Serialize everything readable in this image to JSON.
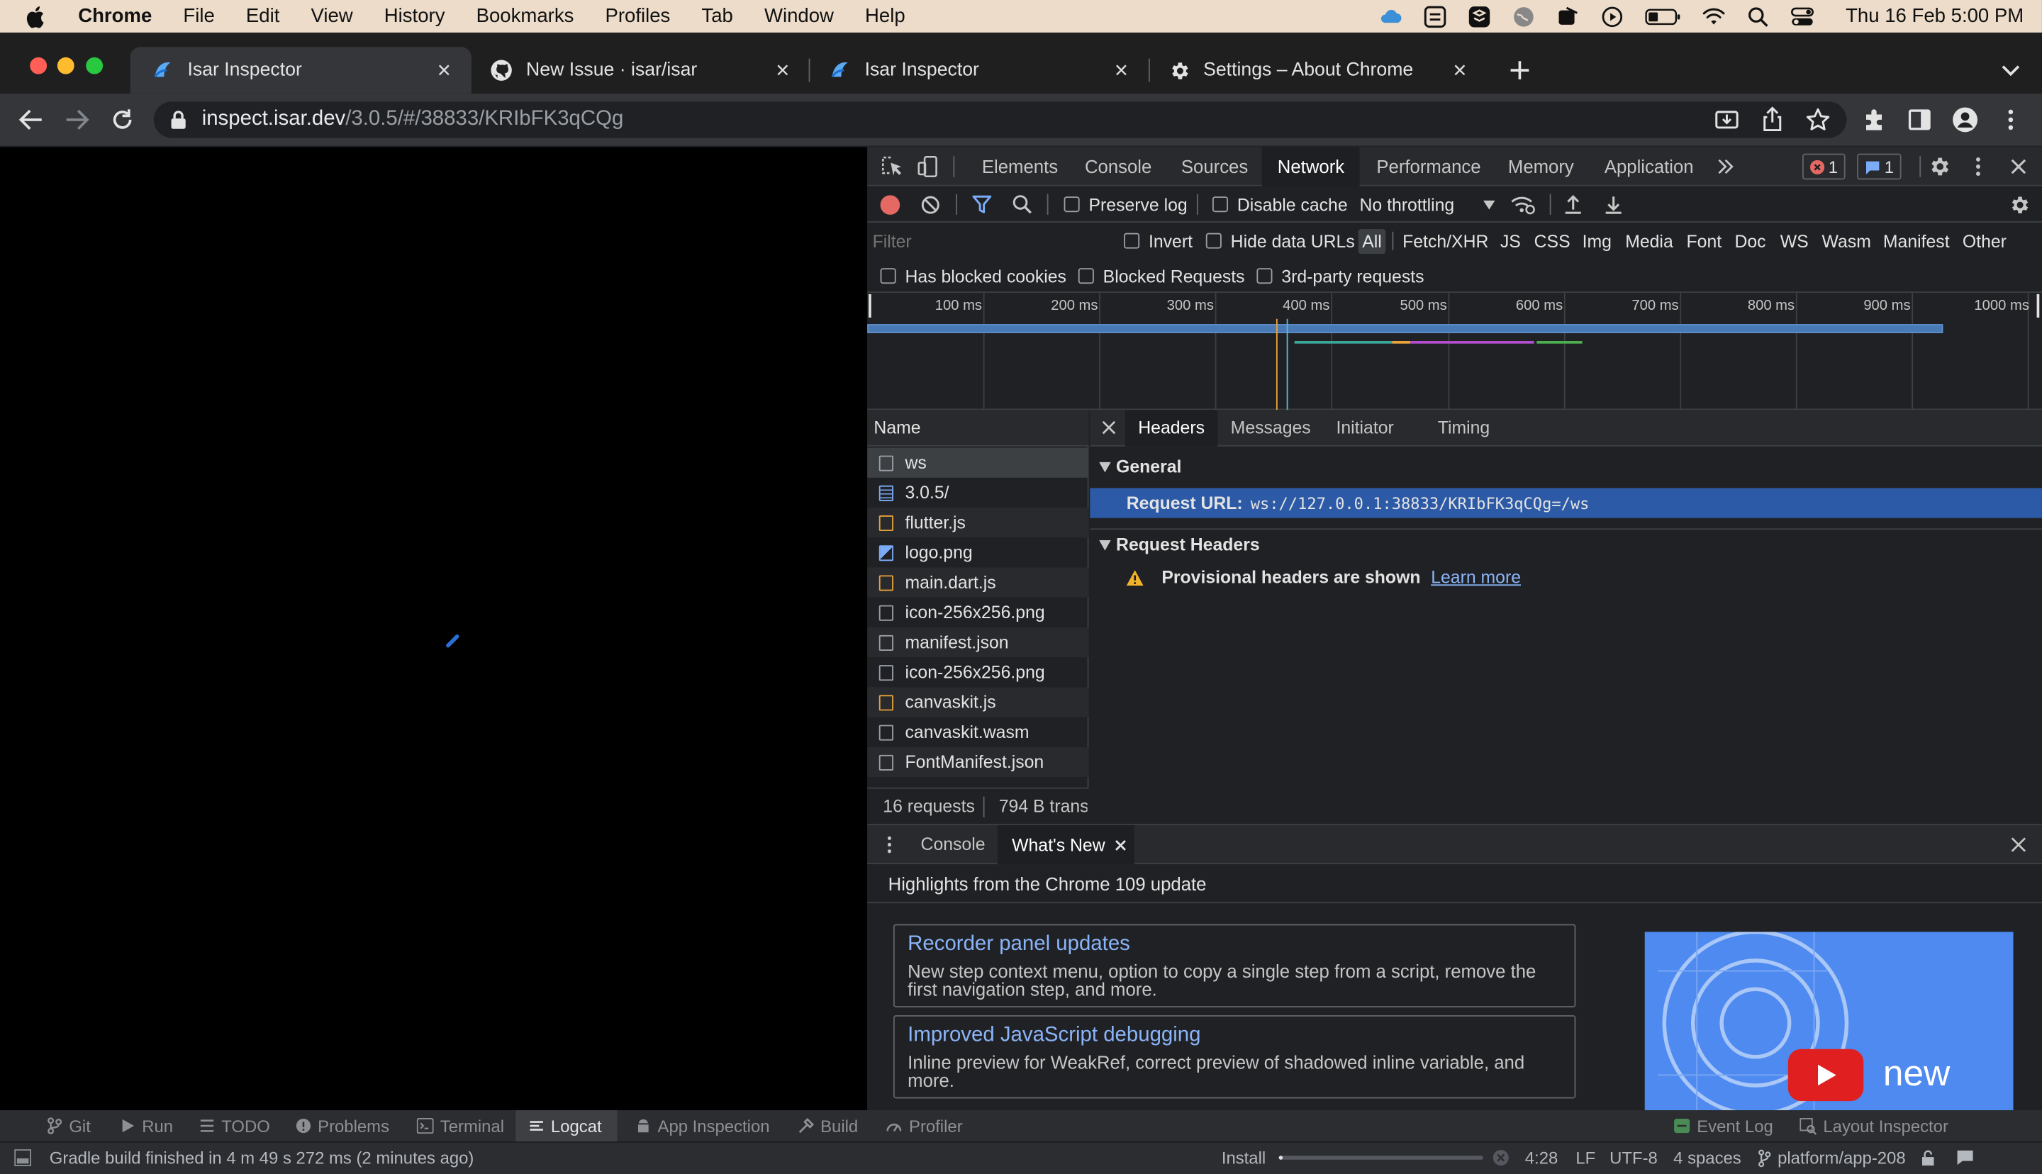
{
  "menubar": {
    "app": "Chrome",
    "items": [
      "File",
      "Edit",
      "View",
      "History",
      "Bookmarks",
      "Profiles",
      "Tab",
      "Window",
      "Help"
    ],
    "clock": "Thu 16 Feb  5:00 PM"
  },
  "tabs": [
    {
      "title": "Isar Inspector",
      "icon": "isar-logo-icon"
    },
    {
      "title": "New Issue · isar/isar",
      "icon": "github-icon"
    },
    {
      "title": "Isar Inspector",
      "icon": "isar-logo-icon"
    },
    {
      "title": "Settings – About Chrome",
      "icon": "gear-icon"
    }
  ],
  "address": {
    "host": "inspect.isar.dev",
    "path": "/3.0.5/#/38833/KRIbFK3qCQg"
  },
  "devtools": {
    "panels": [
      "Elements",
      "Console",
      "Sources",
      "Network",
      "Performance",
      "Memory",
      "Application"
    ],
    "active_panel": "Network",
    "error_count": "1",
    "message_count": "1",
    "netbar": {
      "preserve_log": "Preserve log",
      "disable_cache": "Disable cache",
      "throttling": "No throttling"
    },
    "filter": {
      "placeholder": "Filter",
      "invert": "Invert",
      "hide_data_urls": "Hide data URLs"
    },
    "types": [
      "All",
      "Fetch/XHR",
      "JS",
      "CSS",
      "Img",
      "Media",
      "Font",
      "Doc",
      "WS",
      "Wasm",
      "Manifest",
      "Other"
    ],
    "blocked": {
      "cookies": "Has blocked cookies",
      "requests": "Blocked Requests",
      "third_party": "3rd-party requests"
    },
    "timeline_ticks": [
      "100 ms",
      "200 ms",
      "300 ms",
      "400 ms",
      "500 ms",
      "600 ms",
      "700 ms",
      "800 ms",
      "900 ms",
      "1000 ms"
    ],
    "name_header": "Name",
    "requests": [
      "ws",
      "3.0.5/",
      "flutter.js",
      "logo.png",
      "main.dart.js",
      "icon-256x256.png",
      "manifest.json",
      "icon-256x256.png",
      "canvaskit.js",
      "canvaskit.wasm",
      "FontManifest.json"
    ],
    "summary": {
      "count": "16 requests",
      "transferred": "794 B trans"
    },
    "detail_tabs": [
      "Headers",
      "Messages",
      "Initiator",
      "Timing"
    ],
    "general_title": "General",
    "request_url_label": "Request URL:",
    "request_url_value": "ws://127.0.0.1:38833/KRIbFK3qCQg=/ws",
    "request_headers_title": "Request Headers",
    "provisional_text": "Provisional headers are shown",
    "learn_more": "Learn more",
    "drawer": {
      "tabs": [
        "Console",
        "What's New"
      ],
      "highlight": "Highlights from the Chrome 109 update",
      "cards": [
        {
          "title": "Recorder panel updates",
          "desc": "New step context menu, option to copy a single step from a script, remove the first navigation step, and more."
        },
        {
          "title": "Improved JavaScript debugging",
          "desc": "Inline preview for WeakRef, correct preview of shadowed inline variable, and more."
        }
      ],
      "video_label": "new"
    }
  },
  "ide": {
    "tools": [
      "Git",
      "Run",
      "TODO",
      "Problems",
      "Terminal",
      "Logcat",
      "App Inspection",
      "Build",
      "Profiler"
    ],
    "right_tools": [
      "Event Log",
      "Layout Inspector"
    ],
    "status_message": "Gradle build finished in 4 m 49 s 272 ms (2 minutes ago)",
    "install_label": "Install",
    "position": "4:28",
    "line_ending": "LF",
    "encoding": "UTF-8",
    "indent": "4 spaces",
    "branch": "platform/app-208"
  }
}
